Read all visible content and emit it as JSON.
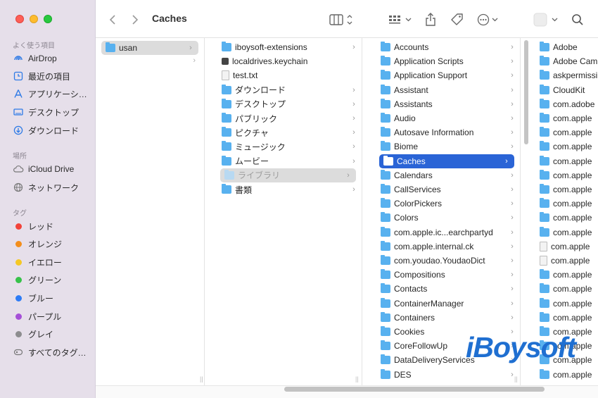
{
  "window": {
    "title": "Caches"
  },
  "sidebar": {
    "favorites_label": "よく使う項目",
    "favorites": [
      {
        "label": "AirDrop",
        "icon": "airdrop-icon"
      },
      {
        "label": "最近の項目",
        "icon": "clock-icon"
      },
      {
        "label": "アプリケーシ…",
        "icon": "applications-icon"
      },
      {
        "label": "デスクトップ",
        "icon": "desktop-icon"
      },
      {
        "label": "ダウンロード",
        "icon": "download-icon"
      }
    ],
    "locations_label": "場所",
    "locations": [
      {
        "label": "iCloud Drive",
        "icon": "cloud-icon"
      },
      {
        "label": "ネットワーク",
        "icon": "globe-icon"
      }
    ],
    "tags_label": "タグ",
    "tags": [
      {
        "label": "レッド",
        "color": "#f2433a"
      },
      {
        "label": "オレンジ",
        "color": "#f38e1c"
      },
      {
        "label": "イエロー",
        "color": "#f5c825"
      },
      {
        "label": "グリーン",
        "color": "#37c24a"
      },
      {
        "label": "ブルー",
        "color": "#2e7cf6"
      },
      {
        "label": "パープル",
        "color": "#a550d7"
      },
      {
        "label": "グレイ",
        "color": "#8d8d8f"
      }
    ],
    "all_tags": "すべてのタグ…"
  },
  "columns": {
    "col1": [
      {
        "name": "usan",
        "kind": "folder",
        "selected": "grey"
      }
    ],
    "col2": [
      {
        "name": "iboysoft-extensions",
        "kind": "folder"
      },
      {
        "name": "localdrives.keychain",
        "kind": "keychain"
      },
      {
        "name": "test.txt",
        "kind": "doc"
      },
      {
        "name": "ダウンロード",
        "kind": "folder"
      },
      {
        "name": "デスクトップ",
        "kind": "folder"
      },
      {
        "name": "パブリック",
        "kind": "folder"
      },
      {
        "name": "ピクチャ",
        "kind": "folder"
      },
      {
        "name": "ミュージック",
        "kind": "folder"
      },
      {
        "name": "ムービー",
        "kind": "folder"
      },
      {
        "name": "ライブラリ",
        "kind": "folder",
        "selected": "grey"
      },
      {
        "name": "書類",
        "kind": "folder"
      }
    ],
    "col3": [
      {
        "name": "Accounts"
      },
      {
        "name": "Application Scripts"
      },
      {
        "name": "Application Support"
      },
      {
        "name": "Assistant"
      },
      {
        "name": "Assistants"
      },
      {
        "name": "Audio"
      },
      {
        "name": "Autosave Information"
      },
      {
        "name": "Biome"
      },
      {
        "name": "Caches",
        "selected": "blue"
      },
      {
        "name": "Calendars"
      },
      {
        "name": "CallServices"
      },
      {
        "name": "ColorPickers"
      },
      {
        "name": "Colors"
      },
      {
        "name": "com.apple.ic...earchpartyd"
      },
      {
        "name": "com.apple.internal.ck"
      },
      {
        "name": "com.youdao.YoudaoDict"
      },
      {
        "name": "Compositions"
      },
      {
        "name": "Contacts"
      },
      {
        "name": "ContainerManager"
      },
      {
        "name": "Containers"
      },
      {
        "name": "Cookies"
      },
      {
        "name": "CoreFollowUp"
      },
      {
        "name": "DataDeliveryServices"
      },
      {
        "name": "DES"
      }
    ],
    "col4": [
      {
        "name": "Adobe",
        "kind": "folder"
      },
      {
        "name": "Adobe Cam",
        "kind": "folder"
      },
      {
        "name": "askpermissi",
        "kind": "folder"
      },
      {
        "name": "CloudKit",
        "kind": "folder"
      },
      {
        "name": "com.adobe",
        "kind": "folder"
      },
      {
        "name": "com.apple",
        "kind": "folder"
      },
      {
        "name": "com.apple",
        "kind": "folder"
      },
      {
        "name": "com.apple",
        "kind": "folder"
      },
      {
        "name": "com.apple",
        "kind": "folder"
      },
      {
        "name": "com.apple",
        "kind": "folder"
      },
      {
        "name": "com.apple",
        "kind": "folder"
      },
      {
        "name": "com.apple",
        "kind": "folder"
      },
      {
        "name": "com.apple",
        "kind": "folder"
      },
      {
        "name": "com.apple",
        "kind": "folder"
      },
      {
        "name": "com.apple",
        "kind": "doc"
      },
      {
        "name": "com.apple",
        "kind": "doc"
      },
      {
        "name": "com.apple",
        "kind": "folder"
      },
      {
        "name": "com.apple",
        "kind": "folder"
      },
      {
        "name": "com.apple",
        "kind": "folder"
      },
      {
        "name": "com.apple",
        "kind": "folder"
      },
      {
        "name": "com.apple",
        "kind": "folder"
      },
      {
        "name": "com.apple",
        "kind": "folder"
      },
      {
        "name": "com.apple",
        "kind": "folder"
      },
      {
        "name": "com.apple",
        "kind": "folder"
      }
    ]
  },
  "watermark": "iBoysoft",
  "colors": {
    "accent": "#2a64d6",
    "folder": "#58b1ef",
    "sidebar": "#e6dfea"
  }
}
